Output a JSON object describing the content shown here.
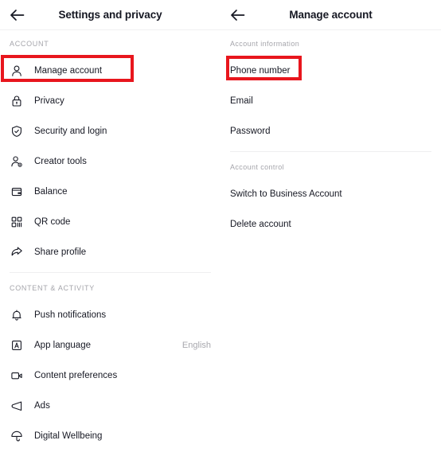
{
  "left_panel": {
    "header": {
      "back_icon": "back-arrow-icon",
      "title": "Settings and privacy"
    },
    "sections": [
      {
        "label": "ACCOUNT",
        "items": [
          {
            "icon": "person-icon",
            "label": "Manage account",
            "value": ""
          },
          {
            "icon": "lock-icon",
            "label": "Privacy",
            "value": ""
          },
          {
            "icon": "shield-check-icon",
            "label": "Security and login",
            "value": ""
          },
          {
            "icon": "person-star-icon",
            "label": "Creator tools",
            "value": ""
          },
          {
            "icon": "wallet-icon",
            "label": "Balance",
            "value": ""
          },
          {
            "icon": "qr-code-icon",
            "label": "QR code",
            "value": ""
          },
          {
            "icon": "share-arrow-icon",
            "label": "Share profile",
            "value": ""
          }
        ]
      },
      {
        "label": "CONTENT & ACTIVITY",
        "items": [
          {
            "icon": "bell-icon",
            "label": "Push notifications",
            "value": ""
          },
          {
            "icon": "letter-a-box-icon",
            "label": "App language",
            "value": "English"
          },
          {
            "icon": "video-camera-icon",
            "label": "Content preferences",
            "value": ""
          },
          {
            "icon": "megaphone-icon",
            "label": "Ads",
            "value": ""
          },
          {
            "icon": "umbrella-icon",
            "label": "Digital Wellbeing",
            "value": ""
          }
        ]
      }
    ]
  },
  "right_panel": {
    "header": {
      "back_icon": "back-arrow-icon",
      "title": "Manage account"
    },
    "sections": [
      {
        "label": "Account information",
        "items": [
          {
            "label": "Phone number"
          },
          {
            "label": "Email"
          },
          {
            "label": "Password"
          }
        ]
      },
      {
        "label": "Account control",
        "items": [
          {
            "label": "Switch to Business Account"
          },
          {
            "label": "Delete account"
          }
        ]
      }
    ]
  },
  "annotations": {
    "color": "#e8161d",
    "boxes": [
      {
        "target": "Manage account"
      },
      {
        "target": "Phone number"
      }
    ]
  },
  "colors": {
    "background": "#ffffff",
    "text_primary": "#161823",
    "text_muted": "#a5a5ab",
    "divider": "#efeff0",
    "highlight": "#e8161d"
  }
}
